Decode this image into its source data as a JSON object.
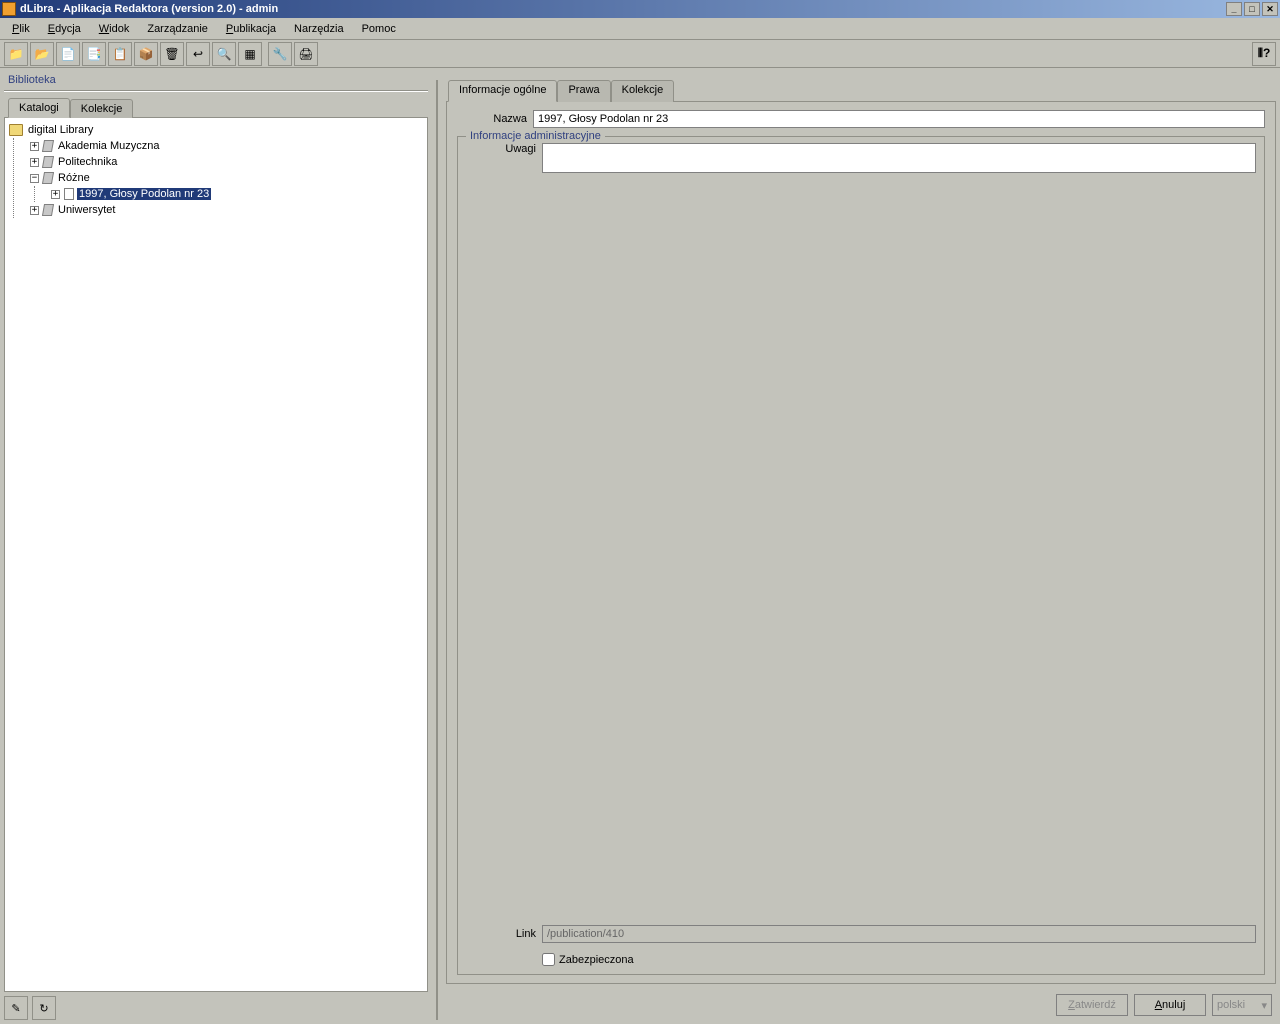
{
  "window": {
    "title": "dLibra - Aplikacja Redaktora (version 2.0) - admin"
  },
  "menu": {
    "items": [
      "Plik",
      "Edycja",
      "Widok",
      "Zarządzanie",
      "Publikacja",
      "Narzędzia",
      "Pomoc"
    ]
  },
  "left": {
    "panel_title": "Biblioteka",
    "tabs": {
      "catalogs": "Katalogi",
      "collections": "Kolekcje"
    },
    "tree": {
      "root": "digital Library",
      "nodes": [
        {
          "label": "Akademia Muzyczna",
          "expandable": true
        },
        {
          "label": "Politechnika",
          "expandable": true
        },
        {
          "label": "Różne",
          "expanded": true,
          "children": [
            {
              "label": "1997, Głosy Podolan nr 23",
              "selected": true,
              "icon": "doc"
            }
          ]
        },
        {
          "label": "Uniwersytet",
          "expandable": true
        }
      ]
    }
  },
  "right": {
    "tabs": {
      "general": "Informacje ogólne",
      "rights": "Prawa",
      "collections": "Kolekcje"
    },
    "name_label": "Nazwa",
    "name_value": "1997, Głosy Podolan nr 23",
    "admin_section": "Informacje administracyjne",
    "notes_label": "Uwagi",
    "notes_value": "",
    "link_label": "Link",
    "link_value": "/publication/410",
    "secured_label": "Zabezpieczona"
  },
  "footer": {
    "confirm": "Zatwierdź",
    "cancel": "Anuluj",
    "lang": "polski"
  }
}
